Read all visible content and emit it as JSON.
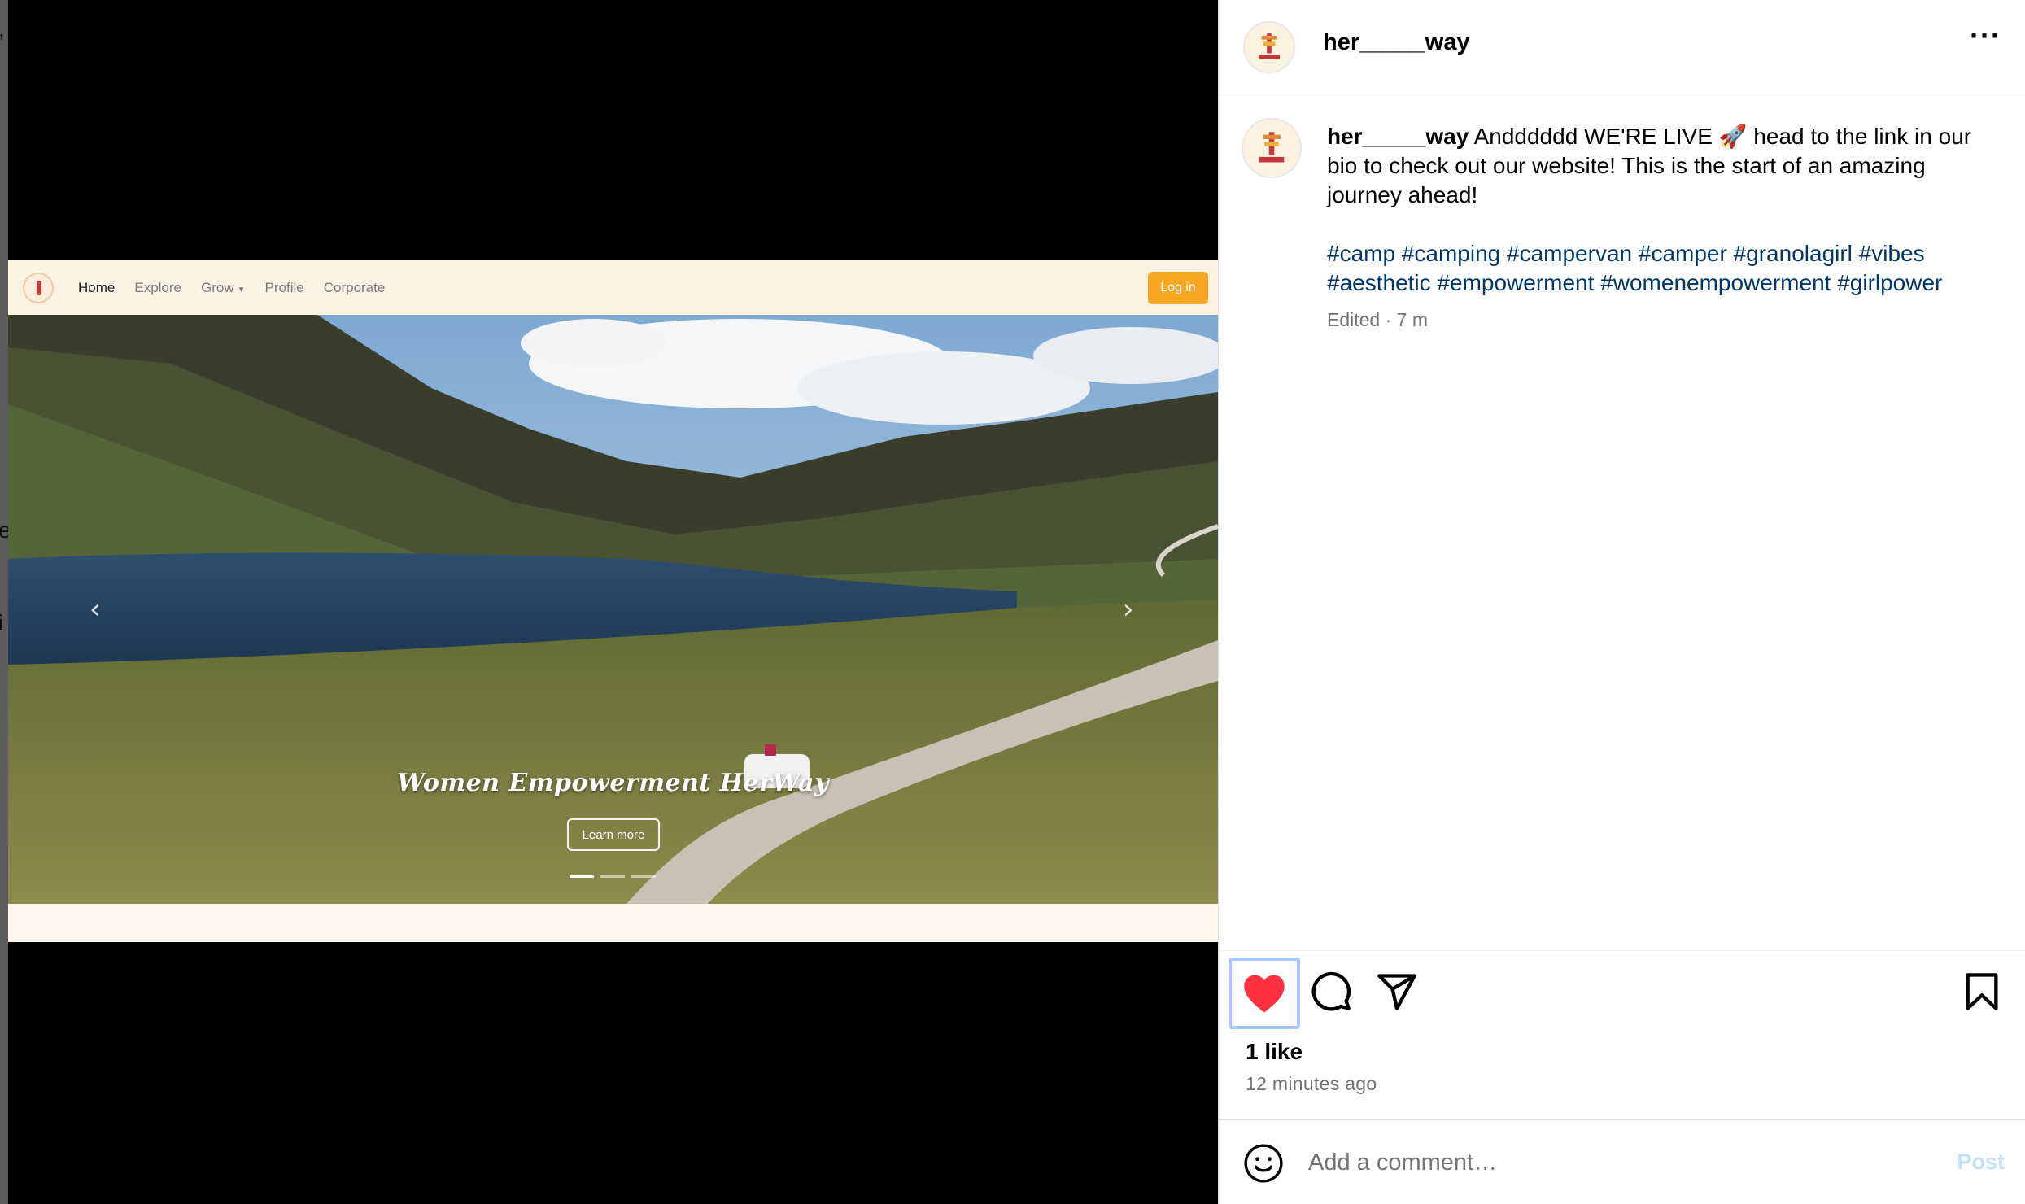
{
  "background_page": {
    "fragments": [
      ",",
      "e",
      "i"
    ]
  },
  "media": {
    "site_nav": {
      "links": [
        {
          "label": "Home",
          "active": true
        },
        {
          "label": "Explore",
          "active": false
        },
        {
          "label": "Grow",
          "active": false,
          "dropdown": true
        },
        {
          "label": "Profile",
          "active": false
        },
        {
          "label": "Corporate",
          "active": false
        }
      ],
      "login_label": "Log in",
      "accent": "#f5a623"
    },
    "hero": {
      "title": "Women Empowerment HerWay",
      "button_label": "Learn more",
      "prev_arrow": "‹",
      "next_arrow": "›",
      "slides": 3,
      "active_slide": 1
    }
  },
  "post": {
    "username": "her_____way",
    "more_icon": "more-horizontal-icon",
    "caption": {
      "username": "her_____way",
      "text": " Andddddd WE'RE LIVE 🚀 head to the link in our bio to check out our website! This is the start of an amazing journey ahead!",
      "hashtags": "#camp #camping #campervan #camper #granolagirl #vibes #aesthetic #empowerment #womenempowerment #girlpower",
      "edited": "Edited · 7 m"
    },
    "actions": {
      "like_icon": "heart-filled-icon",
      "comment_icon": "comment-icon",
      "share_icon": "send-icon",
      "save_icon": "bookmark-icon",
      "liked": true,
      "like_color": "#ff3040"
    },
    "likes": "1 like",
    "time_ago": "12 minutes ago",
    "comment": {
      "placeholder": "Add a comment…",
      "post_label": "Post",
      "post_color": "#c2e0fd"
    },
    "link_color": "#00376b"
  }
}
